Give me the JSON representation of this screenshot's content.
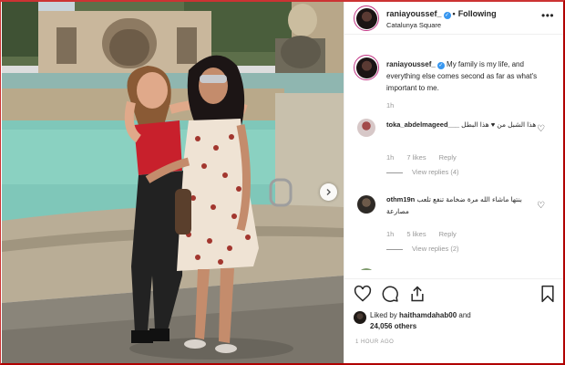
{
  "post": {
    "username": "raniayoussef_",
    "follow_status": "Following",
    "location": "Catalunya Square",
    "more_icon": "ellipsis-icon",
    "caption": "My family is my life, and everything else comes second as far as what's important to me.",
    "caption_time": "1h"
  },
  "comments": [
    {
      "user": "toka_abdelmageed___",
      "text": "هذا الشبل من ♥ هذا البطل",
      "time": "1h",
      "likes": "7 likes",
      "reply": "Reply",
      "view_replies": "View replies (4)"
    },
    {
      "user": "othm19n",
      "text": "بنتها ماشاء الله مرة ضخامة تنفع تلعب مصارعة",
      "time": "1h",
      "likes": "5 likes",
      "reply": "Reply",
      "view_replies": "View replies (2)"
    }
  ],
  "actions": {
    "like_icon": "heart-icon",
    "comment_icon": "comment-icon",
    "share_icon": "share-icon",
    "save_icon": "bookmark-icon"
  },
  "likes": {
    "prefix": "Liked by",
    "user": "haithamdahab00",
    "and": "and",
    "count": "24,056 others"
  },
  "time_ago": "1 HOUR AGO",
  "colors": {
    "verified": "#3897f0",
    "secondary_text": "#999999",
    "border": "#efefef",
    "frame": "#b00000"
  }
}
